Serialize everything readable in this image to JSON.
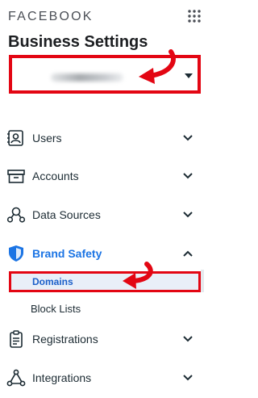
{
  "header": {
    "brand": "FACEBOOK",
    "title": "Business Settings"
  },
  "account_selector": {
    "value_obscured": true
  },
  "sidebar": {
    "items": [
      {
        "label": "Users",
        "icon": "users-icon",
        "expanded": false
      },
      {
        "label": "Accounts",
        "icon": "accounts-icon",
        "expanded": false
      },
      {
        "label": "Data Sources",
        "icon": "data-sources-icon",
        "expanded": false
      },
      {
        "label": "Brand Safety",
        "icon": "shield-icon",
        "expanded": true,
        "active": true,
        "children": [
          {
            "label": "Domains",
            "selected": true
          },
          {
            "label": "Block Lists",
            "selected": false
          }
        ]
      },
      {
        "label": "Registrations",
        "icon": "clipboard-icon",
        "expanded": false
      },
      {
        "label": "Integrations",
        "icon": "integrations-icon",
        "expanded": false
      }
    ]
  },
  "colors": {
    "highlight_red": "#e30613",
    "active_blue": "#1b74e4",
    "selected_bg": "#e9eff8"
  }
}
